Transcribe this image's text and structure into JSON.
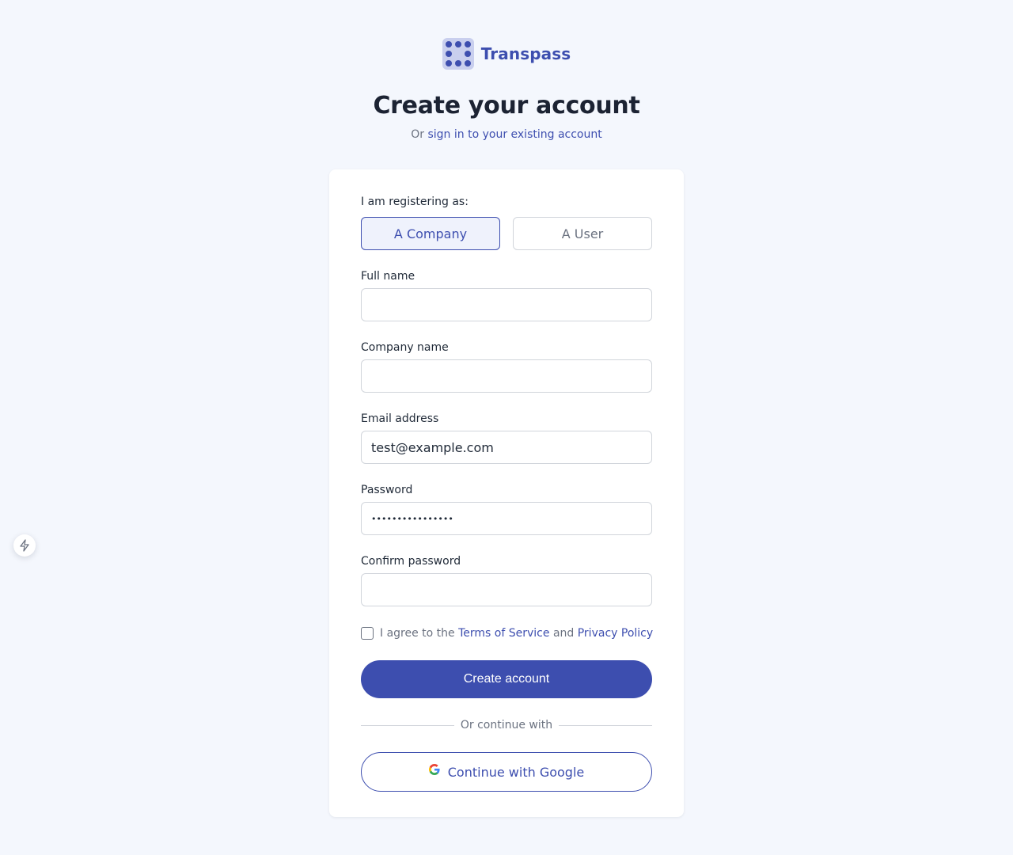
{
  "brand": {
    "name": "Transpass",
    "logo_icon": "grid-dots-icon"
  },
  "header": {
    "title": "Create your account",
    "subtitle_prefix": "Or",
    "subtitle_link": "sign in to your existing account"
  },
  "form": {
    "role_label": "I am registering as:",
    "roles": [
      {
        "label": "A Company",
        "selected": true
      },
      {
        "label": "A User",
        "selected": false
      }
    ],
    "full_name": {
      "label": "Full name",
      "value": ""
    },
    "company_name": {
      "label": "Company name",
      "value": ""
    },
    "email": {
      "label": "Email address",
      "value": "test@example.com"
    },
    "password": {
      "label": "Password",
      "value": "••••••••••••••••"
    },
    "confirm_password": {
      "label": "Confirm password",
      "value": ""
    },
    "agree": {
      "checked": false,
      "prefix": "I agree to the",
      "terms": "Terms of Service",
      "and": "and",
      "privacy": "Privacy Policy"
    },
    "submit_label": "Create account",
    "divider_text": "Or continue with",
    "google_label": "Continue with Google"
  },
  "floating_button": {
    "icon": "lightning-icon"
  },
  "colors": {
    "accent": "#3d4eaf",
    "background": "#f4f7fd",
    "card": "#ffffff",
    "muted_text": "#6b7280",
    "border": "#d1d5db"
  }
}
